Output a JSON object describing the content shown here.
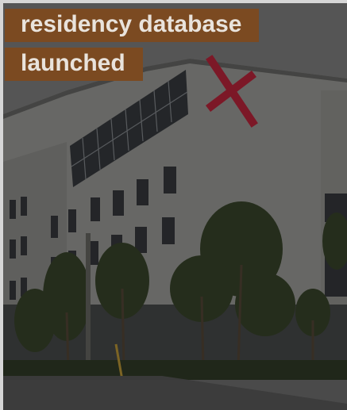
{
  "headline": {
    "text": "residency database launched",
    "background_color": "#7b4a21",
    "text_color": "#e9e3dc"
  },
  "photo": {
    "subject": "building-photo",
    "overlay": "dark-tint"
  },
  "colors": {
    "sky": "#7a7a7a",
    "facade": "#9b9b98",
    "cross_mark": "#c8273f",
    "foliage": "#3d4a2e"
  }
}
